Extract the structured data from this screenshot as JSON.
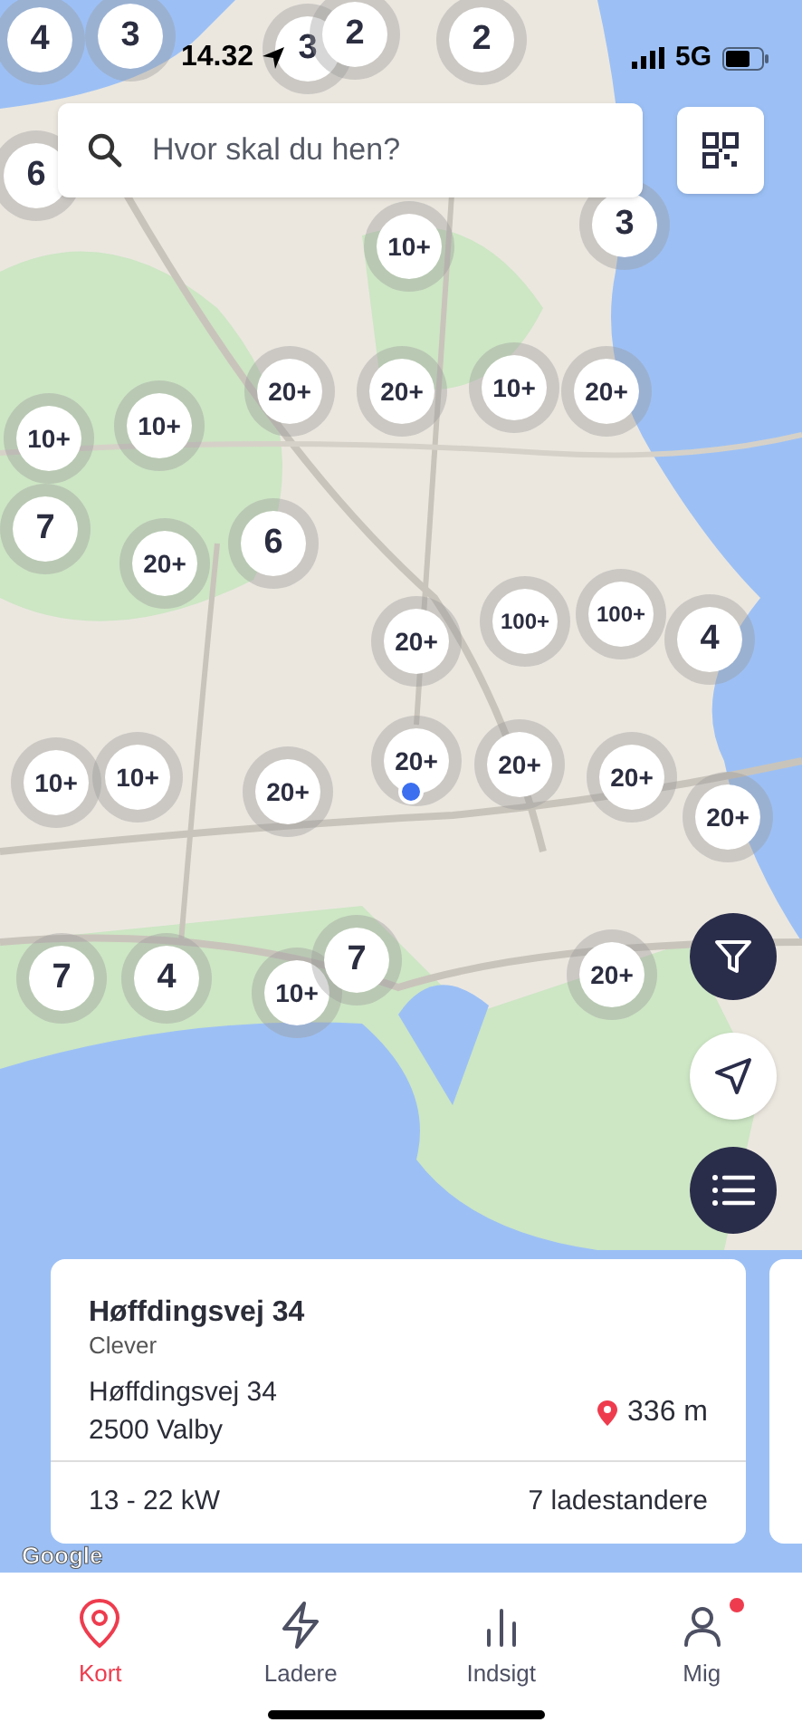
{
  "status_bar": {
    "time": "14.32",
    "network": "5G"
  },
  "search": {
    "placeholder": "Hvor skal du hen?"
  },
  "clusters": [
    {
      "label": "4"
    },
    {
      "label": "3"
    },
    {
      "label": "3"
    },
    {
      "label": "2"
    },
    {
      "label": "2"
    },
    {
      "label": "6"
    },
    {
      "label": "10+"
    },
    {
      "label": "3"
    },
    {
      "label": "20+"
    },
    {
      "label": "20+"
    },
    {
      "label": "10+"
    },
    {
      "label": "20+"
    },
    {
      "label": "10+"
    },
    {
      "label": "10+"
    },
    {
      "label": "7"
    },
    {
      "label": "20+"
    },
    {
      "label": "6"
    },
    {
      "label": "20+"
    },
    {
      "label": "100+"
    },
    {
      "label": "100+"
    },
    {
      "label": "4"
    },
    {
      "label": "20+"
    },
    {
      "label": "20+"
    },
    {
      "label": "20+"
    },
    {
      "label": "20+"
    },
    {
      "label": "10+"
    },
    {
      "label": "10+"
    },
    {
      "label": "20+"
    },
    {
      "label": "7"
    },
    {
      "label": "4"
    },
    {
      "label": "10+"
    },
    {
      "label": "7"
    },
    {
      "label": "20+"
    }
  ],
  "map_attribution": "Google",
  "station_card": {
    "title": "Høffdingsvej 34",
    "operator": "Clever",
    "address_lines": [
      "Høffdingsvej 34",
      "2500 Valby"
    ],
    "distance": "336 m",
    "power": "13 - 22 kW",
    "chargers": "7 ladestandere"
  },
  "tabs": [
    {
      "label": "Kort",
      "selected": true,
      "badge": false
    },
    {
      "label": "Ladere",
      "selected": false,
      "badge": false
    },
    {
      "label": "Indsigt",
      "selected": false,
      "badge": false
    },
    {
      "label": "Mig",
      "selected": false,
      "badge": true
    }
  ]
}
